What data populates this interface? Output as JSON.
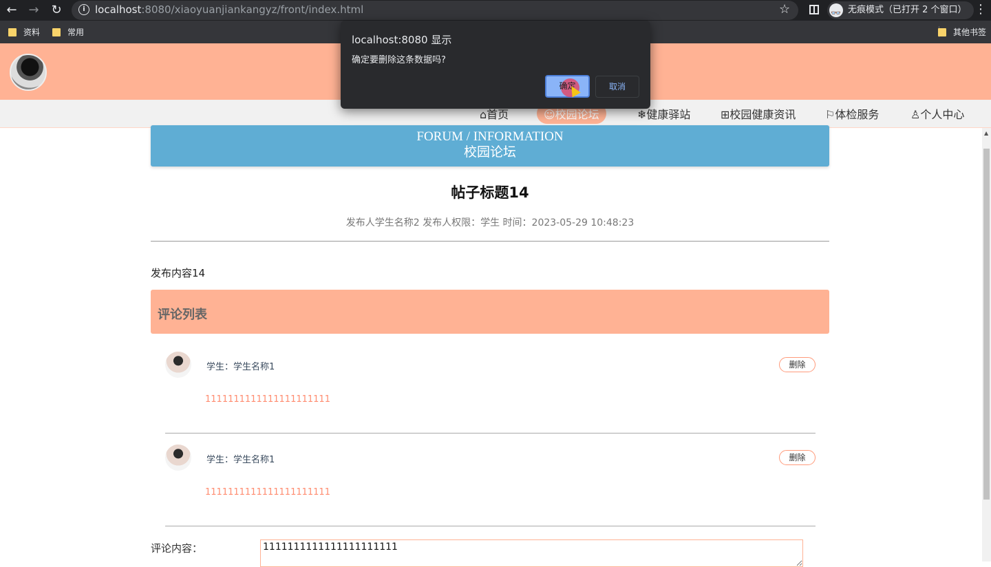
{
  "browser": {
    "url_host": "localhost",
    "url_rest": ":8080/xiaoyuanjiankangyz/front/index.html",
    "incognito_label": "无痕模式（已打开 2 个窗口）",
    "bookmarks": [
      "资料",
      "常用"
    ],
    "other_bookmarks": "其他书签"
  },
  "nav": {
    "items": [
      {
        "icon": "home-icon",
        "label": "⌂首页"
      },
      {
        "icon": "forum-icon",
        "label": "☺校园论坛",
        "active": true
      },
      {
        "icon": "snowflake-icon",
        "label": "❄健康驿站"
      },
      {
        "icon": "news-icon",
        "label": "⊞校园健康资讯"
      },
      {
        "icon": "flag-icon",
        "label": "⚐体检服务"
      },
      {
        "icon": "user-icon",
        "label": "♙个人中心"
      }
    ]
  },
  "banner": {
    "en": "FORUM / INFORMATION",
    "cn": "校园论坛"
  },
  "post": {
    "title": "帖子标题14",
    "meta": "发布人学生名称2   发布人权限：学生   时间：2023-05-29 10:48:23",
    "content": "发布内容14"
  },
  "comments": {
    "header": "评论列表",
    "items": [
      {
        "user": "学生：学生名称1",
        "delete_label": "删除",
        "text": "1111111111111111111111"
      },
      {
        "user": "学生：学生名称1",
        "delete_label": "删除",
        "text": "1111111111111111111111"
      }
    ]
  },
  "form": {
    "label": "评论内容：",
    "value": "1111111111111111111111"
  },
  "dialog": {
    "title": "localhost:8080 显示",
    "message": "确定要删除这条数据吗?",
    "ok_label": "确定",
    "cancel_label": "取消"
  },
  "colors": {
    "header_bg": "#ffb294",
    "banner_bg": "#5fadd4",
    "accent": "#ff8c70"
  }
}
